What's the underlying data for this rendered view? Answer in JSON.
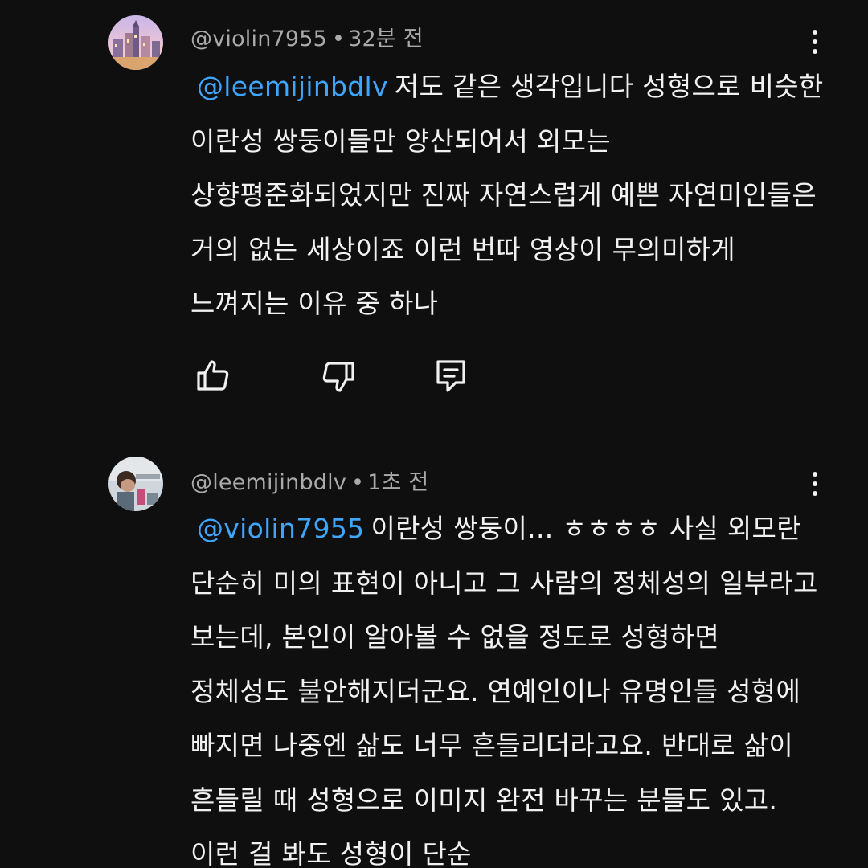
{
  "comments": [
    {
      "author": "@violin7955",
      "separator": "•",
      "time": "32분 전",
      "mention": "@leemijinbdlv",
      "text": "저도 같은 생각입니다 성형으로 비슷한 이란성 쌍둥이들만 양산되어서 외모는 상향평준화되었지만 진짜 자연스럽게 예쁜 자연미인들은 거의 없는 세상이죠 이런 번따 영상이 무의미하게 느껴지는 이유 중 하나",
      "avatar_icon": "avatar-illustration-icon"
    },
    {
      "author": "@leemijinbdlv",
      "separator": "•",
      "time": "1초 전",
      "mention": "@violin7955",
      "text": "이란성 쌍둥이... ㅎㅎㅎㅎ 사실 외모란 단순히 미의 표현이 아니고 그 사람의 정체성의 일부라고 보는데, 본인이 알아볼 수 없을 정도로 성형하면 정체성도 불안해지더군요. 연예인이나 유명인들 성형에 빠지면 나중엔 삶도 너무 흔들리더라고요. 반대로 삶이 흔들릴 때 성형으로 이미지 완전 바꾸는 분들도 있고. 이런 걸 봐도 성형이 단순",
      "avatar_icon": "avatar-photo-icon"
    }
  ],
  "actions": {
    "like_icon": "thumbs-up-icon",
    "dislike_icon": "thumbs-down-icon",
    "reply_icon": "reply-icon"
  },
  "colors": {
    "background": "#0f0f0f",
    "text": "#f1f1f1",
    "meta": "#aaaaaa",
    "mention": "#3ea6ff"
  }
}
